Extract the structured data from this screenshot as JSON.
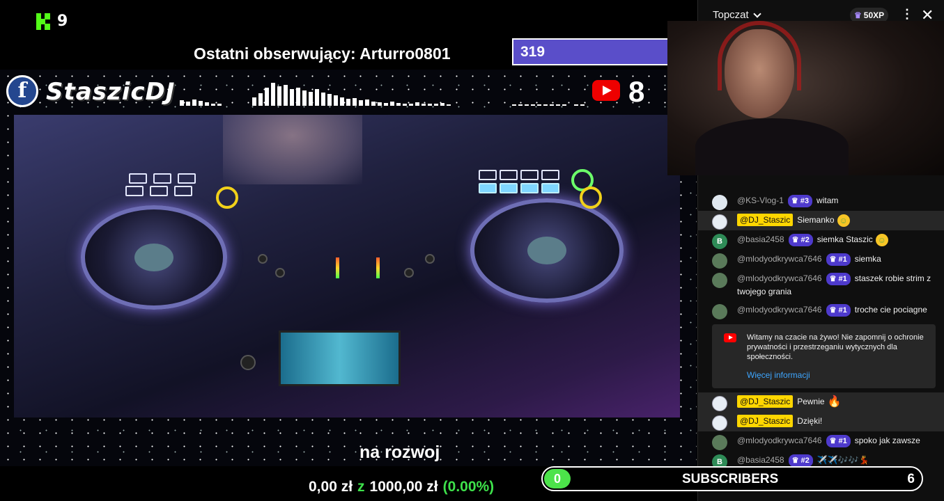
{
  "stream": {
    "kick_viewers": "9",
    "last_follower": "Ostatni obserwujący: Arturro0801",
    "counter_box": "319",
    "brand": "StaszicDJ",
    "youtube_viewers": "8",
    "caption": "na rozwoj",
    "donation": {
      "current": "0,00 zł",
      "separator": "z",
      "goal": "1000,00 zł",
      "percent": "(0.00%)"
    },
    "subscribers": {
      "current": "0",
      "label": "SUBSCRIBERS",
      "goal": "6",
      "progress_fraction": 0.0
    }
  },
  "chat": {
    "title": "Topczat",
    "xp": "50XP",
    "notice": {
      "text": "Witamy na czacie na żywo! Nie zapomnij o ochronie prywatności i przestrzeganiu wytycznych dla społeczności.",
      "link": "Więcej informacji"
    },
    "messages_before": [
      {
        "author": "@KS-Vlog-1",
        "badge": "#3",
        "text": "witam",
        "avatar": "",
        "emoji": ""
      },
      {
        "author": "@DJ_Staszic",
        "owner": true,
        "text": "Siemanko",
        "avatar": "",
        "emoji": "☺"
      },
      {
        "author": "@basia2458",
        "badge": "#2",
        "text": "siemka Staszic",
        "avatar": "B",
        "emoji": "☺"
      },
      {
        "author": "@mlodyodkrywca7646",
        "badge": "#1",
        "text": "siemka",
        "avatar": "",
        "emoji": ""
      },
      {
        "author": "@mlodyodkrywca7646",
        "badge": "#1",
        "text": "staszek robie strim z twojego grania",
        "avatar": "",
        "emoji": ""
      },
      {
        "author": "@mlodyodkrywca7646",
        "badge": "#1",
        "text": "troche cie pociagne",
        "avatar": "",
        "emoji": ""
      }
    ],
    "messages_after": [
      {
        "author": "@DJ_Staszic",
        "owner": true,
        "text": "Pewnie",
        "avatar": "",
        "emoji": "🔥"
      },
      {
        "author": "@DJ_Staszic",
        "owner": true,
        "text": "Dzięki!",
        "avatar": "",
        "emoji": ""
      },
      {
        "author": "@mlodyodkrywca7646",
        "badge": "#1",
        "text": "spoko jak zawsze",
        "avatar": "",
        "emoji": ""
      },
      {
        "author": "@basia2458",
        "badge": "#2",
        "text": "✈️✈️🎶🎶💃",
        "avatar": "B",
        "emoji": ""
      }
    ]
  },
  "colors": {
    "kick_green": "#53fc18",
    "accent_purple": "#5a4ec9",
    "owner_yellow": "#ffd600",
    "link_blue": "#3ea6ff",
    "progress_green": "#4ce34a"
  },
  "icons": [
    "kick-logo-icon",
    "facebook-icon",
    "youtube-icon",
    "crown-icon",
    "more-options-icon",
    "close-icon",
    "chevron-down-icon",
    "fire-icon",
    "smiley-icon"
  ]
}
